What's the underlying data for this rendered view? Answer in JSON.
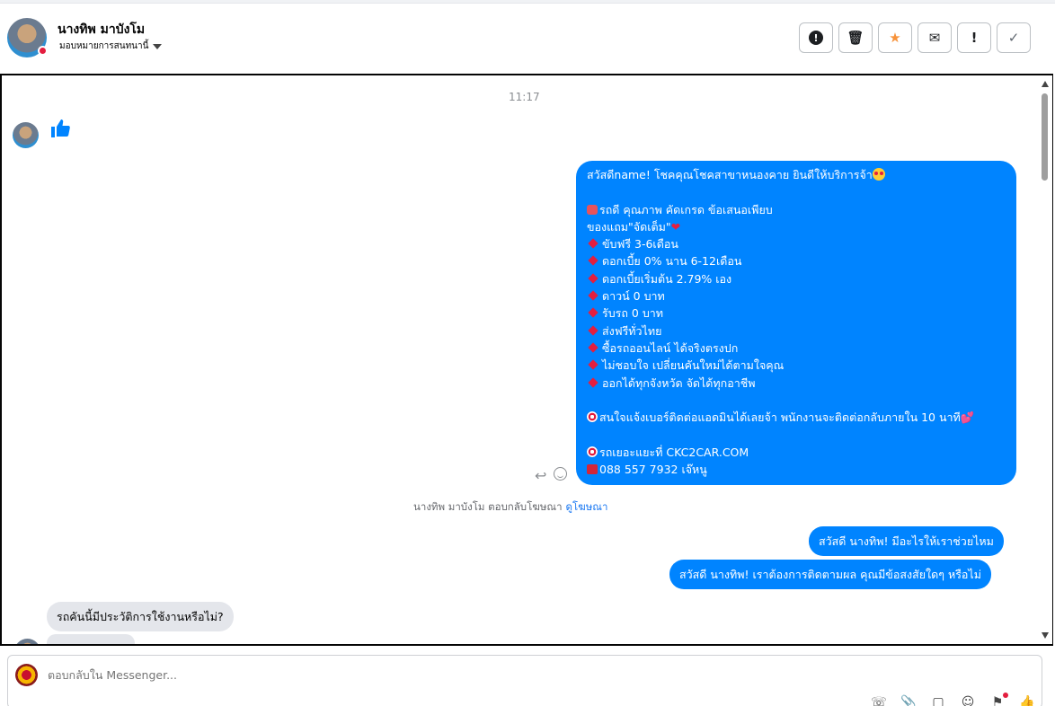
{
  "header": {
    "contact_name": "นางทิพ มาบังโม",
    "assign_label": "มอบหมายการสนทนานี้",
    "actions": [
      {
        "name": "report-icon",
        "glyph": "!"
      },
      {
        "name": "trash-icon",
        "glyph": "🗑"
      },
      {
        "name": "star-icon",
        "glyph": "★"
      },
      {
        "name": "mail-icon",
        "glyph": "✉"
      },
      {
        "name": "exclamation-icon",
        "glyph": "!"
      },
      {
        "name": "check-icon",
        "glyph": "✓"
      }
    ]
  },
  "chat": {
    "timestamp": "11:17",
    "big_message": {
      "l1": "สวัสดีname! โชคคุณโชคสาขาหนองคาย ยินดีให้บริการจ้า",
      "l2": "รถดี คุณภาพ คัดเกรด ข้อเสนอเพียบ",
      "l3": "ของแถม\"จัดเต็ม\"",
      "items": [
        "ขับฟรี 3-6เดือน",
        "ดอกเบี้ย 0% นาน 6-12เดือน",
        "ดอกเบี้ยเริ่มต้น 2.79% เอง",
        "ดาวน์ 0 บาท",
        "รับรถ 0 บาท",
        "ส่งฟรีทั่วไทย",
        "ซื้อรถออนไลน์ ได้จริงตรงปก",
        "ไม่ชอบใจ เปลี่ยนคันใหม่ได้ตามใจคุณ",
        "ออกได้ทุกจังหวัด จัดได้ทุกอาชีพ"
      ],
      "l4": "สนใจแจ้งเบอร์ติดต่อแอดมินได้เลยจ้า พนักงานจะติดต่อกลับภายใน 10 นาที",
      "l5": "รถเยอะแยะที่ CKC2CAR.COM",
      "l6": "088 557 7932 เจ๊หนู"
    },
    "ad_reply_text": "นางทิพ มาบังโม ตอบกลับโฆษณา",
    "ad_reply_link": "ดูโฆษณา",
    "out_msg_1": "สวัสดี นางทิพ! มีอะไรให้เราช่วยไหม",
    "out_msg_2": "สวัสดี นางทิพ! เราต้องการติดตามผล คุณมีข้อสงสัยใดๆ หรือไม่",
    "in_msg_1": "รถคันนี้มีประวัติการใช้งานหรือไม่?"
  },
  "composer": {
    "placeholder": "ตอบกลับใน Messenger..."
  }
}
